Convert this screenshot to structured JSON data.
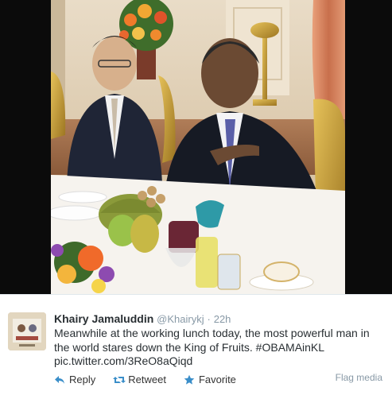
{
  "tweet": {
    "author": {
      "fullname": "Khairy Jamaluddin",
      "username": "@Khairykj"
    },
    "separator": "·",
    "timestamp": "22h",
    "text_lines": [
      "Meanwhile at the working lunch today, the most powerful man in",
      "the world stares down the King of Fruits. #OBAMAinKL",
      "pic.twitter.com/3ReO8aQiqd"
    ],
    "actions": {
      "reply": "Reply",
      "retweet": "Retweet",
      "favorite": "Favorite"
    },
    "flag_media": "Flag media"
  },
  "colors": {
    "name": "#292f33",
    "muted": "#8899a6",
    "action_icon": "#3a8ec9",
    "photo_frame": "#0b0b0b"
  },
  "icons": [
    "reply-icon",
    "retweet-icon",
    "favorite-icon"
  ]
}
